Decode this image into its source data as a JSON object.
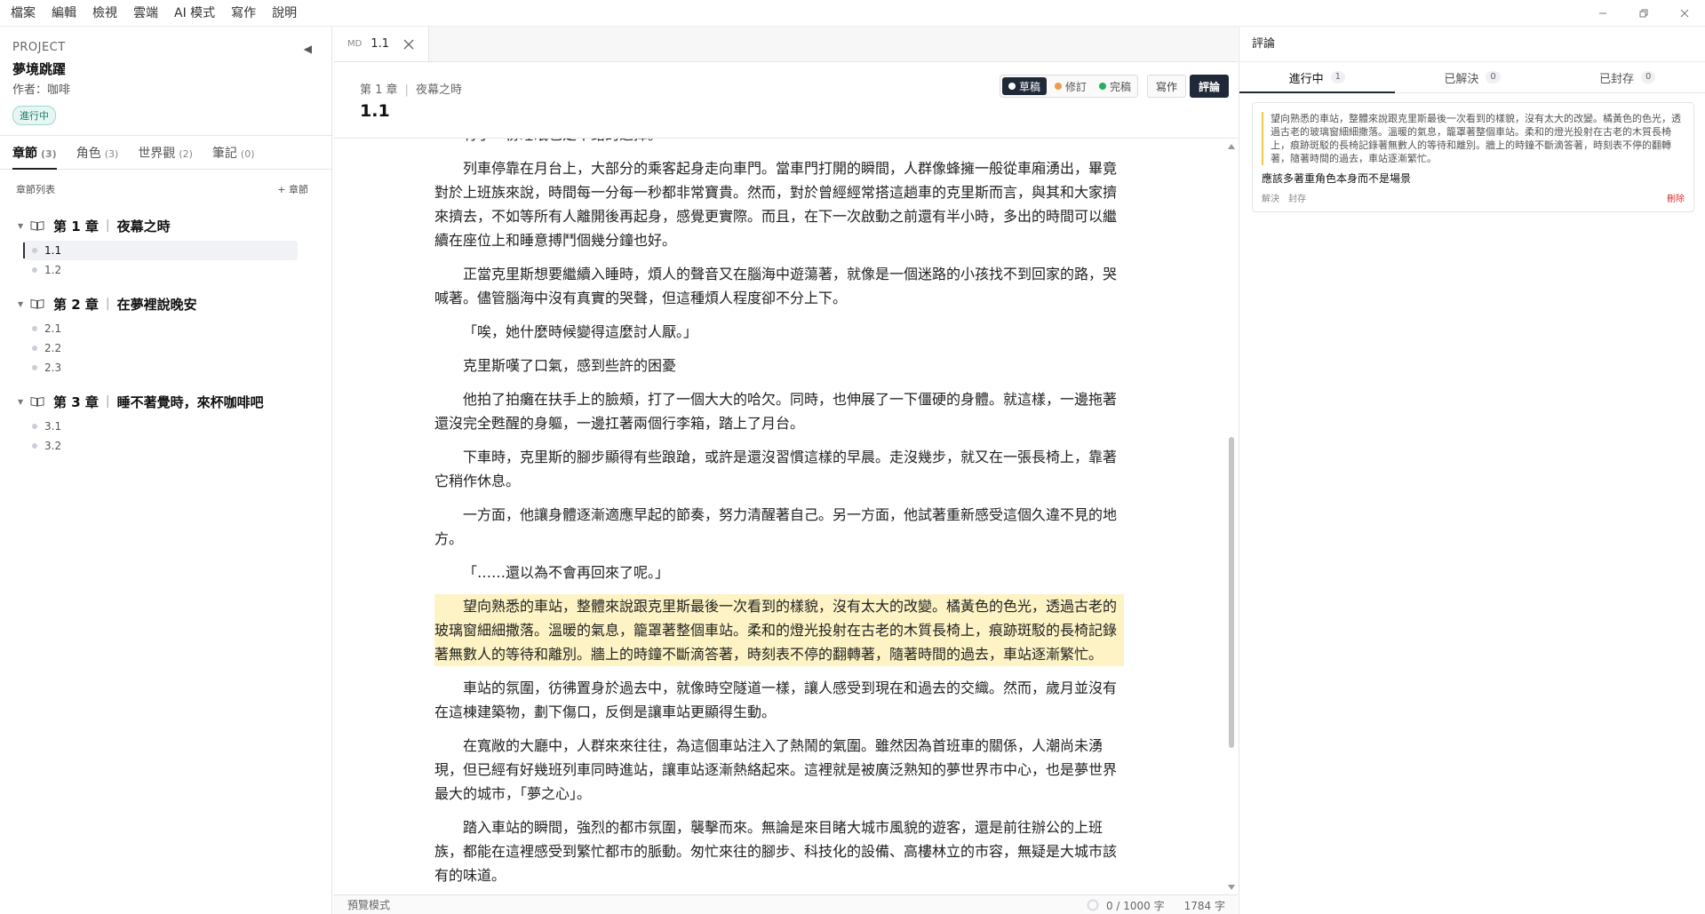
{
  "menu": [
    "檔案",
    "編輯",
    "檢視",
    "雲端",
    "AI 模式",
    "寫作",
    "說明"
  ],
  "sidebar": {
    "project_label": "PROJECT",
    "title": "夢境跳躍",
    "author": "作者：咖啡",
    "status": "進行中",
    "tabs": [
      {
        "label": "章節",
        "count": "(3)"
      },
      {
        "label": "角色",
        "count": "(3)"
      },
      {
        "label": "世界觀",
        "count": "(2)"
      },
      {
        "label": "筆記",
        "count": "(0)"
      }
    ],
    "list_title": "章節列表",
    "add_chapter": "+ 章節",
    "chapters": [
      {
        "num": "第 1 章",
        "name": "夜幕之時",
        "sections": [
          "1.1",
          "1.2"
        ]
      },
      {
        "num": "第 2 章",
        "name": "在夢裡說晚安",
        "sections": [
          "2.1",
          "2.2",
          "2.3"
        ]
      },
      {
        "num": "第 3 章",
        "name": "睡不著覺時，來杯咖啡吧",
        "sections": [
          "3.1",
          "3.2"
        ]
      }
    ]
  },
  "editor": {
    "tab": {
      "badge": "MD",
      "title": "1.1"
    },
    "breadcrumb": {
      "chapter": "第 1 章",
      "name": "夜幕之時"
    },
    "title": "1.1",
    "statuses": [
      {
        "label": "草稿",
        "color": "#ffffff"
      },
      {
        "label": "修訂",
        "color": "#f2994a"
      },
      {
        "label": "完稿",
        "color": "#27ae60"
      }
    ],
    "modes": [
      "寫作",
      "評論"
    ],
    "paragraphs": [
      "有了一份睡眠也是不錯的選擇。",
      "列車停靠在月台上，大部分的乘客起身走向車門。當車門打開的瞬間，人群像蜂擁一般從車廂湧出，畢竟對於上班族來說，時間每一分每一秒都非常寶貴。然而，對於曾經經常搭這趟車的克里斯而言，與其和大家擠來擠去，不如等所有人離開後再起身，感覺更實際。而且，在下一次啟動之前還有半小時，多出的時間可以繼續在座位上和睡意搏鬥個幾分鐘也好。",
      "正當克里斯想要繼續入睡時，煩人的聲音又在腦海中遊蕩著，就像是一個迷路的小孩找不到回家的路，哭喊著。儘管腦海中沒有真實的哭聲，但這種煩人程度卻不分上下。",
      "「唉，她什麼時候變得這麼討人厭。」",
      "克里斯嘆了口氣，感到些許的困憂",
      "他拍了拍癱在扶手上的臉頰，打了一個大大的哈欠。同時，也伸展了一下僵硬的身體。就這樣，一邊拖著還沒完全甦醒的身軀，一邊扛著兩個行李箱，踏上了月台。",
      "下車時，克里斯的腳步顯得有些踉蹌，或許是還沒習慣這樣的早晨。走沒幾步，就又在一張長椅上，靠著它稍作休息。",
      "一方面，他讓身體逐漸適應早起的節奏，努力清醒著自己。另一方面，他試著重新感受這個久違不見的地方。",
      "「……還以為不會再回來了呢。」",
      "望向熟悉的車站，整體來說跟克里斯最後一次看到的樣貌，沒有太大的改變。橘黃色的色光，透過古老的玻璃窗細細撒落。溫暖的氣息，籠罩著整個車站。柔和的燈光投射在古老的木質長椅上，痕跡斑駁的長椅記錄著無數人的等待和離別。牆上的時鐘不斷滴答著，時刻表不停的翻轉著，隨著時間的過去，車站逐漸繁忙。",
      "車站的氛圍，彷彿置身於過去中，就像時空隧道一樣，讓人感受到現在和過去的交織。然而，歲月並沒有在這棟建築物，劃下傷口，反倒是讓車站更顯得生動。",
      "在寬敞的大廳中，人群來來往往，為這個車站注入了熱鬧的氣圍。雖然因為首班車的關係，人潮尚未湧現，但已經有好幾班列車同時進站，讓車站逐漸熱絡起來。這裡就是被廣泛熟知的夢世界市中心，也是夢世界最大的城市，「夢之心」。",
      "踏入車站的瞬間，強烈的都市氛圍，襲擊而來。無論是來目睹大城市風貌的遊客，還是前往辦公的上班族，都能在這裡感受到繁忙都市的脈動。匆忙來往的腳步、科技化的設備、高樓林立的市容，無疑是大城市該有的味道。"
    ],
    "highlight_index": 9
  },
  "statusbar": {
    "mode": "預覽模式",
    "goal": "0 / 1000 字",
    "words": "1784 字"
  },
  "comments": {
    "title": "評論",
    "tabs": [
      {
        "label": "進行中",
        "count": "1"
      },
      {
        "label": "已解決",
        "count": "0"
      },
      {
        "label": "已封存",
        "count": "0"
      }
    ],
    "items": [
      {
        "quote": "望向熟悉的車站，整體來說跟克里斯最後一次看到的樣貌，沒有太大的改變。橘黃色的色光，透過古老的玻璃窗細細撒落。溫暖的氣息，籠罩著整個車站。柔和的燈光投射在古老的木質長椅上，痕跡斑駁的長椅記錄著無數人的等待和離別。牆上的時鐘不斷滴答著，時刻表不停的翻轉著，隨著時間的過去，車站逐漸繁忙。",
        "text": "應該多著重角色本身而不是場景",
        "actions": [
          "解決",
          "封存"
        ],
        "delete": "刪除"
      }
    ]
  },
  "colors": {
    "accent": "#1f2937",
    "highlight": "#fdf3c4",
    "status_badge": "#1e7a6e"
  }
}
